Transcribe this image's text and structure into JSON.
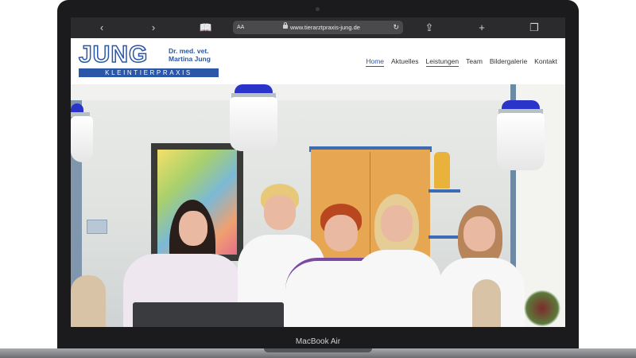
{
  "browser": {
    "text_size_label": "AA",
    "url": "www.tierarztpraxis-jung.de",
    "icons": [
      "back-icon",
      "forward-icon",
      "bookmarks-icon",
      "lock-icon",
      "reload-icon",
      "share-icon",
      "new-tab-icon",
      "tabs-icon"
    ]
  },
  "logo": {
    "word": "JUNG",
    "title": "Dr. med. vet.",
    "name": "Martina Jung",
    "subtitle": "KLEINTIERPRAXIS",
    "brand_color": "#2a57a8"
  },
  "nav": {
    "items": [
      {
        "label": "Home"
      },
      {
        "label": "Aktuelles"
      },
      {
        "label": "Leistungen"
      },
      {
        "label": "Team"
      },
      {
        "label": "Bildergalerie"
      },
      {
        "label": "Kontakt"
      }
    ]
  },
  "device": {
    "brand": "MacBook Air"
  }
}
